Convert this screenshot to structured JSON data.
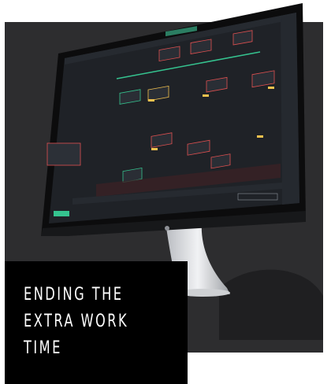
{
  "caption": {
    "lines": [
      "ENDING THE",
      "EXTRA WORK",
      "TIME"
    ]
  },
  "colors": {
    "panel": "#2d2d2f",
    "caption_bg": "#000000",
    "screen_bg": "#1e2126",
    "accent_green": "#35c38f",
    "accent_red": "#e05050",
    "accent_yellow": "#f2c14e"
  }
}
